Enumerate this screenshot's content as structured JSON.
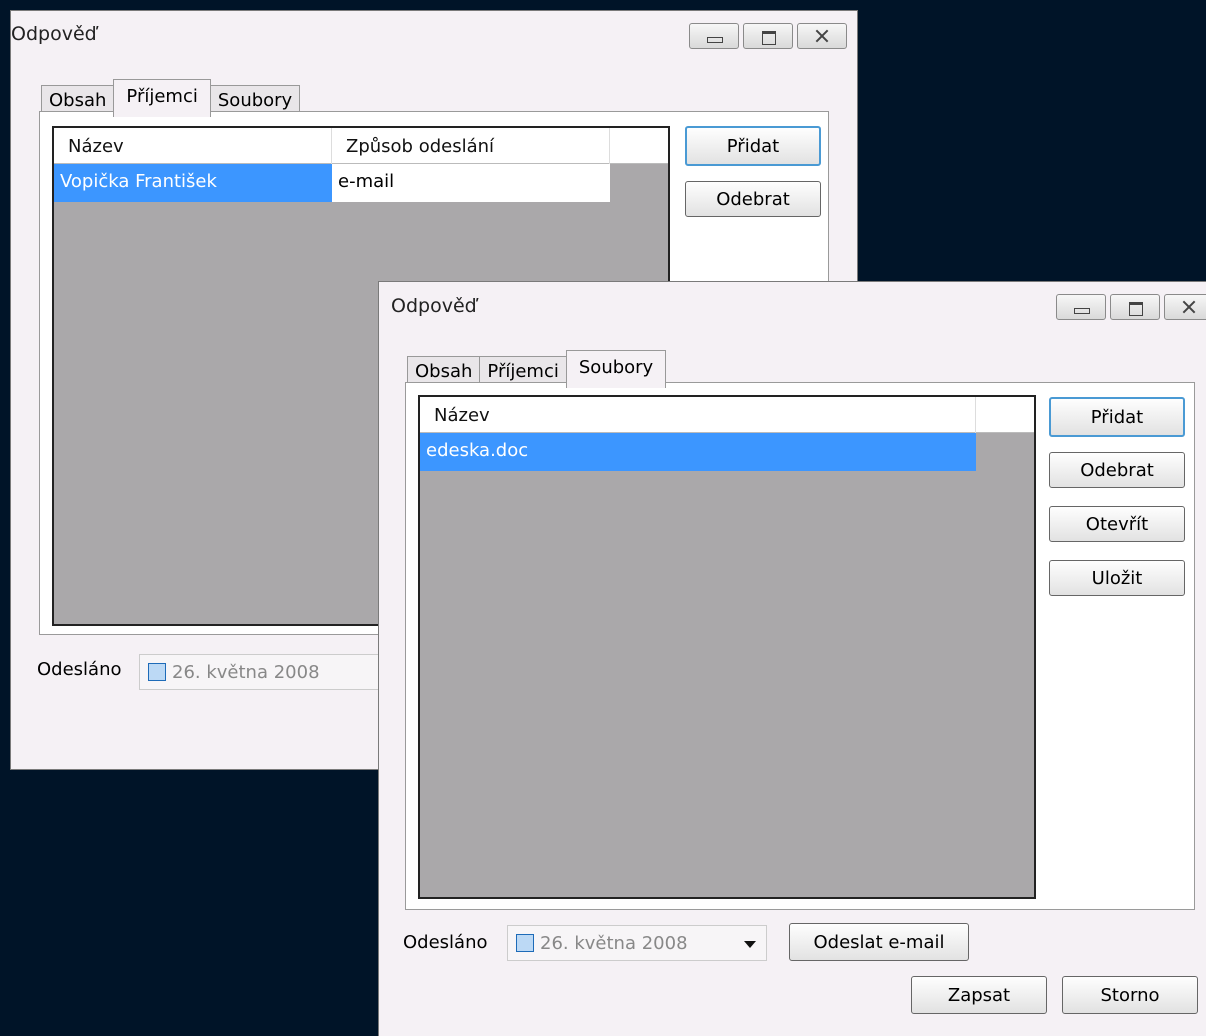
{
  "window_back": {
    "title": "Odpověď",
    "tabs": [
      "Obsah",
      "Příjemci",
      "Soubory"
    ],
    "list": {
      "columns": [
        "Název",
        "Způsob odeslání"
      ],
      "rows": [
        [
          "Vopička František",
          "e-mail"
        ]
      ]
    },
    "buttons": {
      "add": "Přidat",
      "remove": "Odebrat"
    },
    "sent_label": "Odesláno",
    "sent_date": "26.  května  2008"
  },
  "window_front": {
    "title": "Odpověď",
    "tabs": [
      "Obsah",
      "Příjemci",
      "Soubory"
    ],
    "list": {
      "columns": [
        "Název"
      ],
      "rows": [
        [
          "edeska.doc"
        ]
      ]
    },
    "buttons": {
      "add": "Přidat",
      "remove": "Odebrat",
      "open": "Otevřít",
      "save": "Uložit",
      "send_email": "Odeslat e-mail",
      "write": "Zapsat",
      "cancel": "Storno"
    },
    "sent_label": "Odesláno",
    "sent_date": "26.  května  2008"
  },
  "colors": {
    "selection": "#3c96ff",
    "desktop": "#001428",
    "list_bg": "#aaa8aa"
  }
}
